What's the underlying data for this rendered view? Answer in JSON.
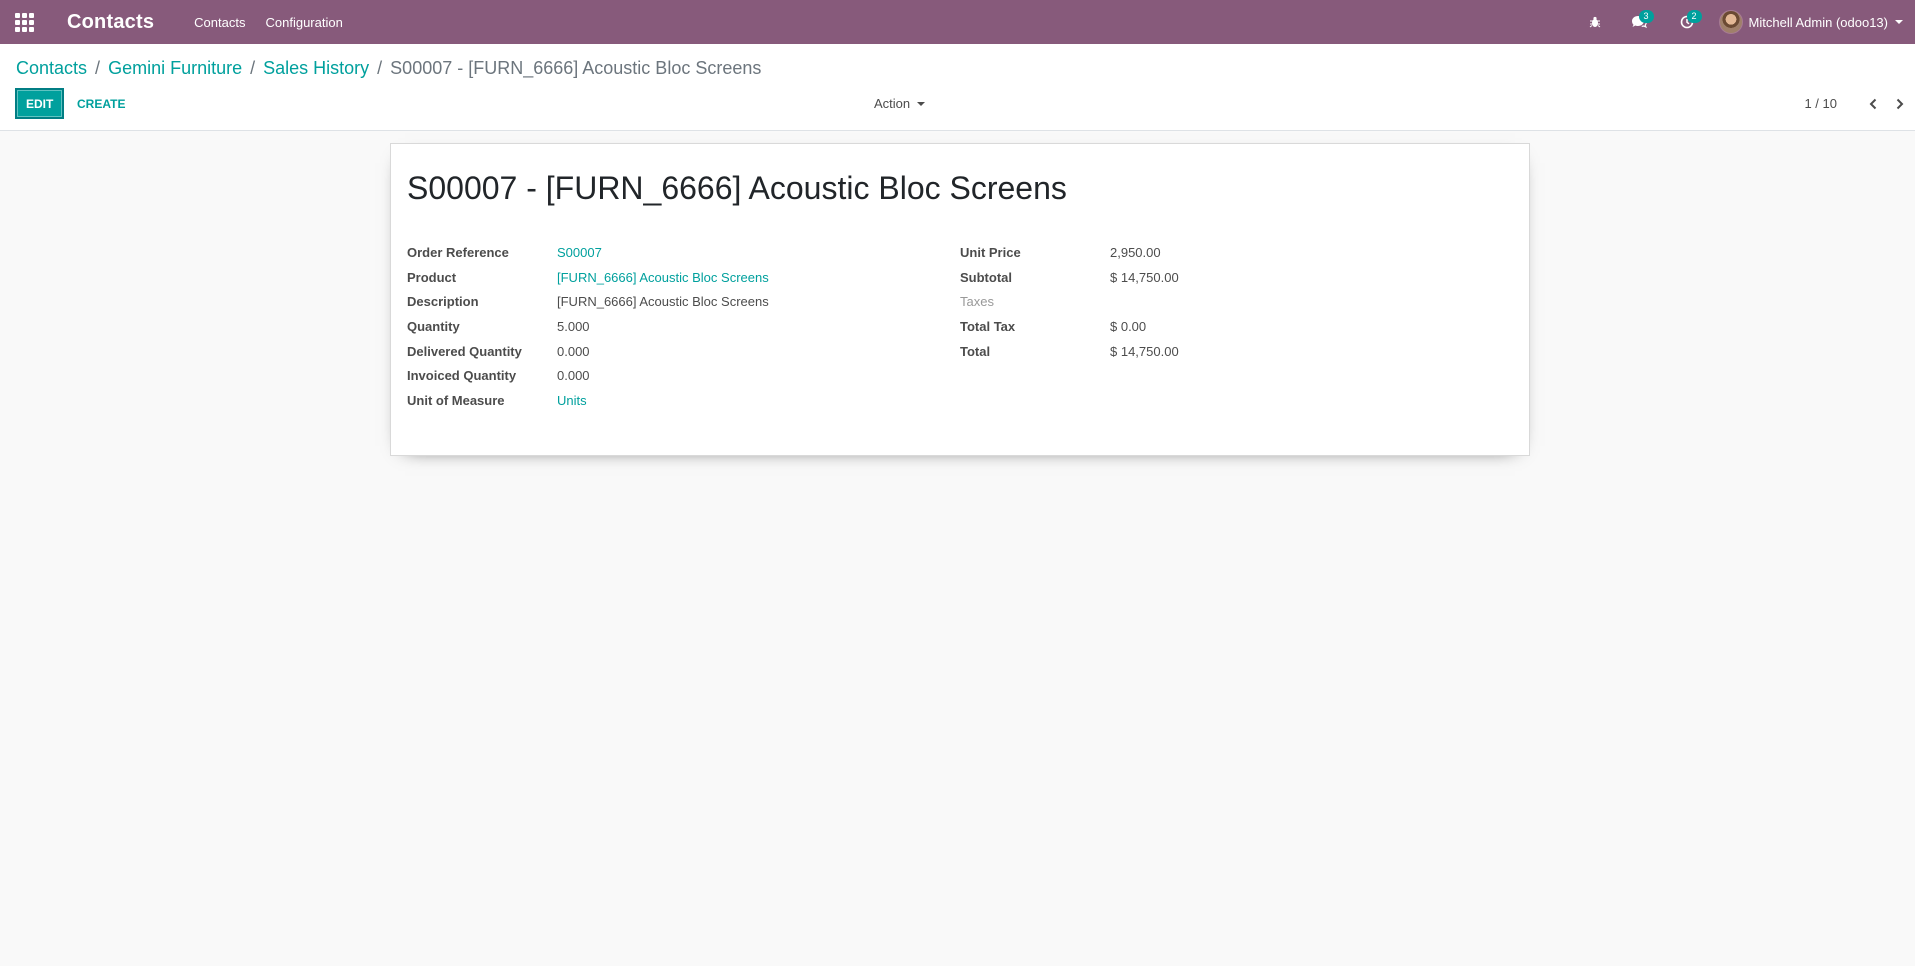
{
  "navbar": {
    "app_title": "Contacts",
    "menu": [
      "Contacts",
      "Configuration"
    ],
    "chat_count": "3",
    "activity_count": "2",
    "user_name": "Mitchell Admin (odoo13)",
    "accent": "#875a7b"
  },
  "breadcrumb": {
    "items": [
      "Contacts",
      "Gemini Furniture",
      "Sales History"
    ],
    "current": "S00007 - [FURN_6666] Acoustic Bloc Screens",
    "separator": "/"
  },
  "toolbar": {
    "edit_label": "EDIT",
    "create_label": "CREATE",
    "action_label": "Action",
    "pager": "1 / 10"
  },
  "record": {
    "title": "S00007 - [FURN_6666] Acoustic Bloc Screens",
    "left": [
      {
        "label": "Order Reference",
        "value": "S00007"
      },
      {
        "label": "Product",
        "value": "[FURN_6666] Acoustic Bloc Screens"
      },
      {
        "label": "Description",
        "value": "[FURN_6666] Acoustic Bloc Screens"
      },
      {
        "label": "Quantity",
        "value": "5.000"
      },
      {
        "label": "Delivered Quantity",
        "value": "0.000"
      },
      {
        "label": "Invoiced Quantity",
        "value": "0.000"
      },
      {
        "label": "Unit of Measure",
        "value": "Units"
      }
    ],
    "right": [
      {
        "label": "Unit Price",
        "value": "2,950.00"
      },
      {
        "label": "Subtotal",
        "value": "$ 14,750.00"
      },
      {
        "label": "Taxes",
        "value": ""
      },
      {
        "label": "Total Tax",
        "value": "$ 0.00"
      },
      {
        "label": "Total",
        "value": "$ 14,750.00"
      }
    ]
  },
  "colors": {
    "primary": "#00a09d",
    "navbar": "#875a7b"
  }
}
